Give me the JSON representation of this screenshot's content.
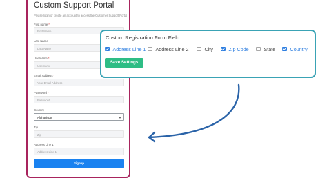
{
  "portal": {
    "title": "Custom Support Portal",
    "subtitle": "Please login or create an account to access the Customer Support Portal",
    "fields": {
      "first_name": {
        "label": "First name",
        "required": "*",
        "placeholder": "First Name"
      },
      "last_name": {
        "label": "Last Name",
        "placeholder": "Last Name"
      },
      "username": {
        "label": "Username",
        "required": "*",
        "placeholder": "Username"
      },
      "email": {
        "label": "Email Address",
        "required": "*",
        "placeholder": "Your Email Address"
      },
      "password": {
        "label": "Password",
        "required": "*",
        "placeholder": "Password"
      },
      "country": {
        "label": "Country",
        "value": "Afghanistan"
      },
      "zip": {
        "label": "Zip",
        "placeholder": "Zip"
      },
      "address_line_1": {
        "label": "Address Line 1",
        "placeholder": "Address Line 1"
      }
    },
    "signup_label": "Signup"
  },
  "settings": {
    "title": "Custom Registration Form Field",
    "options": [
      {
        "label": "Address Line 1",
        "checked": true
      },
      {
        "label": "Address Line 2",
        "checked": false
      },
      {
        "label": "City",
        "checked": false
      },
      {
        "label": "Zip Code",
        "checked": true
      },
      {
        "label": "State",
        "checked": false
      },
      {
        "label": "Country",
        "checked": true
      }
    ],
    "save_label": "Save Settings"
  },
  "colors": {
    "portal_border": "#a8245d",
    "panel_border": "#3aa3b5",
    "checkbox_accent": "#2f7fe0",
    "save_button": "#2ebd85",
    "signup_button": "#1a82f0",
    "arrow": "#2a63a8"
  },
  "icons": {
    "select_caret": "chevron-down-icon",
    "curved_arrow": "curved-arrow-icon"
  }
}
